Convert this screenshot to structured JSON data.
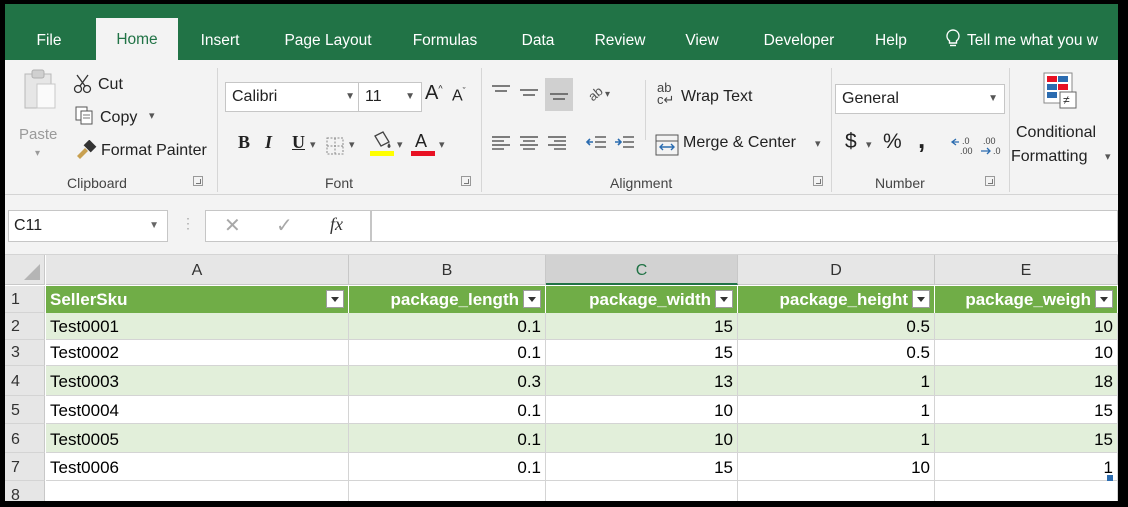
{
  "ribbon_tabs": [
    {
      "label": "File"
    },
    {
      "label": "Home"
    },
    {
      "label": "Insert"
    },
    {
      "label": "Page Layout"
    },
    {
      "label": "Formulas"
    },
    {
      "label": "Data"
    },
    {
      "label": "Review"
    },
    {
      "label": "View"
    },
    {
      "label": "Developer"
    },
    {
      "label": "Help"
    }
  ],
  "active_tab": "Home",
  "tell_me": "Tell me what you w",
  "clipboard": {
    "paste_label": "Paste",
    "cut_label": "Cut",
    "copy_label": "Copy",
    "format_painter_label": "Format Painter",
    "group_label": "Clipboard"
  },
  "font": {
    "font_name": "Calibri",
    "font_size": "11",
    "bold": "B",
    "italic": "I",
    "underline": "U",
    "grow": "A",
    "shrink": "A",
    "font_color_letter": "A",
    "group_label": "Font"
  },
  "alignment": {
    "wrap_text_label": "Wrap Text",
    "wrap_icon_text": "ab",
    "merge_center_label": "Merge & Center",
    "group_label": "Alignment"
  },
  "number": {
    "format_value": "General",
    "currency_symbol": "$",
    "percent_symbol": "%",
    "comma_symbol": ",",
    "group_label": "Number"
  },
  "styles": {
    "conditional_label_1": "Conditional",
    "conditional_label_2": "Formatting"
  },
  "formula_bar": {
    "name_box": "C11",
    "fx_label": "fx",
    "formula_value": ""
  },
  "columns": [
    "A",
    "B",
    "C",
    "D",
    "E"
  ],
  "selected_column": "C",
  "row_numbers": [
    "1",
    "2",
    "3",
    "4",
    "5",
    "6",
    "7",
    "8"
  ],
  "table": {
    "headers": [
      "SellerSku",
      "package_length",
      "package_width",
      "package_height",
      "package_weigh"
    ],
    "rows": [
      [
        "Test0001",
        "0.1",
        "15",
        "0.5",
        "10"
      ],
      [
        "Test0002",
        "0.1",
        "15",
        "0.5",
        "10"
      ],
      [
        "Test0003",
        "0.3",
        "13",
        "1",
        "18"
      ],
      [
        "Test0004",
        "0.1",
        "10",
        "1",
        "15"
      ],
      [
        "Test0005",
        "0.1",
        "10",
        "1",
        "15"
      ],
      [
        "Test0006",
        "0.1",
        "15",
        "10",
        "1"
      ]
    ]
  },
  "colors": {
    "excel_green": "#217346",
    "table_header": "#70ad47",
    "table_band": "#e2efda",
    "font_color_bar": "#e81123",
    "highlight_bar": "#ffff00"
  }
}
